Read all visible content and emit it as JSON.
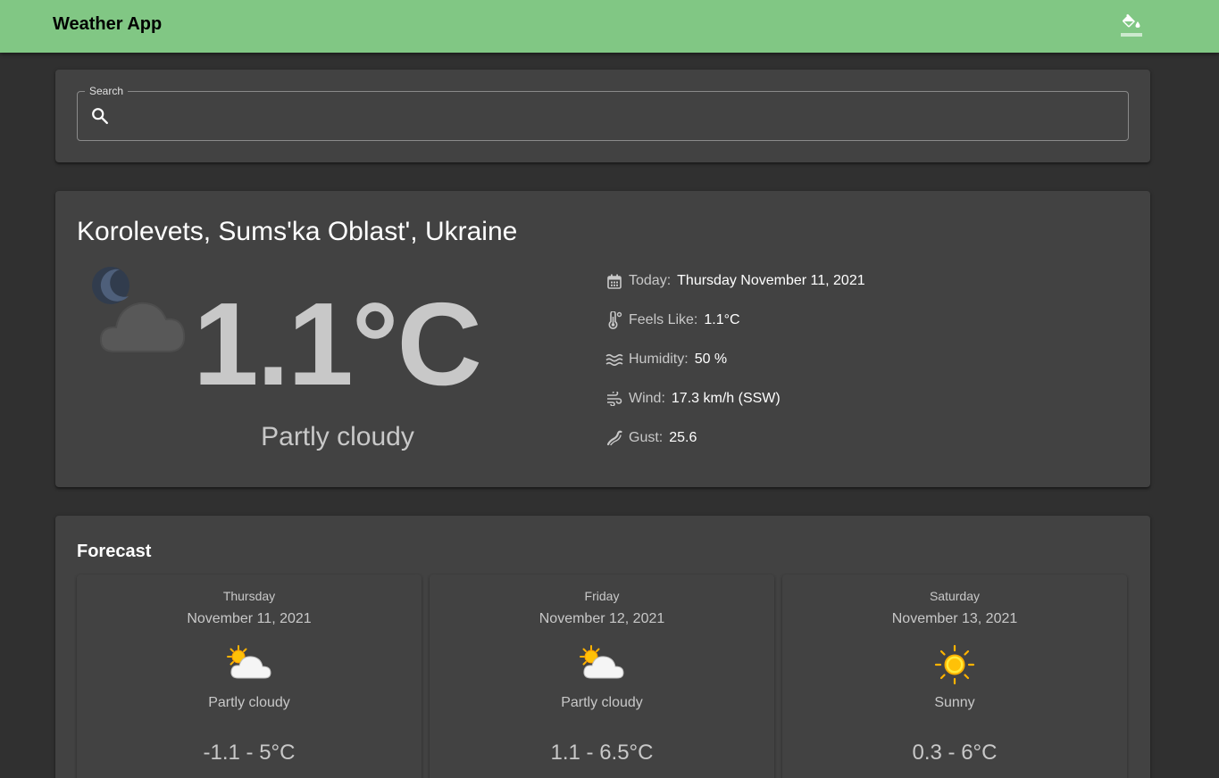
{
  "app": {
    "title": "Weather App"
  },
  "search": {
    "label": "Search",
    "value": "",
    "placeholder": ""
  },
  "current": {
    "location": "Korolevets, Sums'ka Oblast', Ukraine",
    "temperature": "1.1°C",
    "condition": "Partly cloudy",
    "icon": "partly-cloudy-night-icon",
    "details": [
      {
        "icon": "calendar-icon",
        "label": "Today:",
        "value": "Thursday November 11, 2021"
      },
      {
        "icon": "thermometer-icon",
        "label": "Feels Like:",
        "value": "1.1°C"
      },
      {
        "icon": "humidity-icon",
        "label": "Humidity:",
        "value": "50 %"
      },
      {
        "icon": "wind-icon",
        "label": "Wind:",
        "value": "17.3 km/h (SSW)"
      },
      {
        "icon": "gust-icon",
        "label": "Gust:",
        "value": "25.6"
      }
    ]
  },
  "forecast": {
    "title": "Forecast",
    "days": [
      {
        "day": "Thursday",
        "date": "November 11, 2021",
        "icon": "partly-cloudy-icon",
        "condition": "Partly cloudy",
        "range": "-1.1 - 5°C"
      },
      {
        "day": "Friday",
        "date": "November 12, 2021",
        "icon": "partly-cloudy-icon",
        "condition": "Partly cloudy",
        "range": "1.1 - 6.5°C"
      },
      {
        "day": "Saturday",
        "date": "November 13, 2021",
        "icon": "sun-icon",
        "condition": "Sunny",
        "range": "0.3 - 6°C"
      }
    ]
  },
  "colors": {
    "appbar": "#81c784",
    "background": "#303030",
    "card": "#424242",
    "muted_text": "#c8c8c8",
    "sun": "#ffc107"
  }
}
